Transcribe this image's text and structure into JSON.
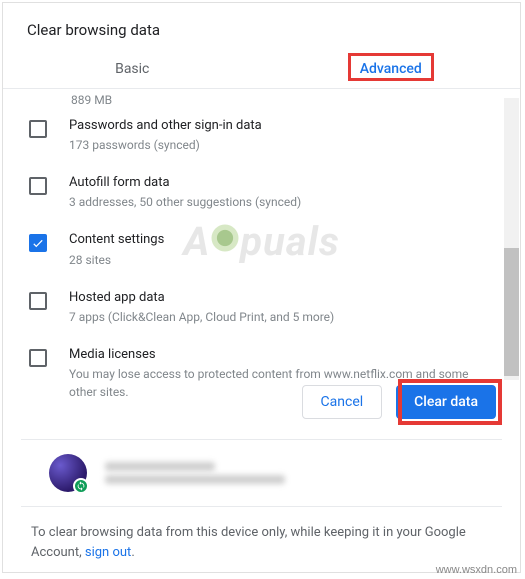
{
  "dialog": {
    "title": "Clear browsing data",
    "tabs": {
      "basic": "Basic",
      "advanced": "Advanced"
    },
    "truncated_size": "889 MB",
    "items": [
      {
        "title": "Passwords and other sign-in data",
        "sub": "173 passwords (synced)",
        "checked": false
      },
      {
        "title": "Autofill form data",
        "sub": "3 addresses, 50 other suggestions (synced)",
        "checked": false
      },
      {
        "title": "Content settings",
        "sub": "28 sites",
        "checked": true
      },
      {
        "title": "Hosted app data",
        "sub": "7 apps (Click&Clean App, Cloud Print, and 5 more)",
        "checked": false
      },
      {
        "title": "Media licenses",
        "sub": "You may lose access to protected content from www.netflix.com and some other sites.",
        "checked": false
      }
    ],
    "buttons": {
      "cancel": "Cancel",
      "clear": "Clear data"
    },
    "footer": {
      "text": "To clear browsing data from this device only, while keeping it in your Google Account, ",
      "link": "sign out",
      "tail": "."
    }
  },
  "watermark": "A  puals",
  "source_url": "www.wsxdn.com"
}
